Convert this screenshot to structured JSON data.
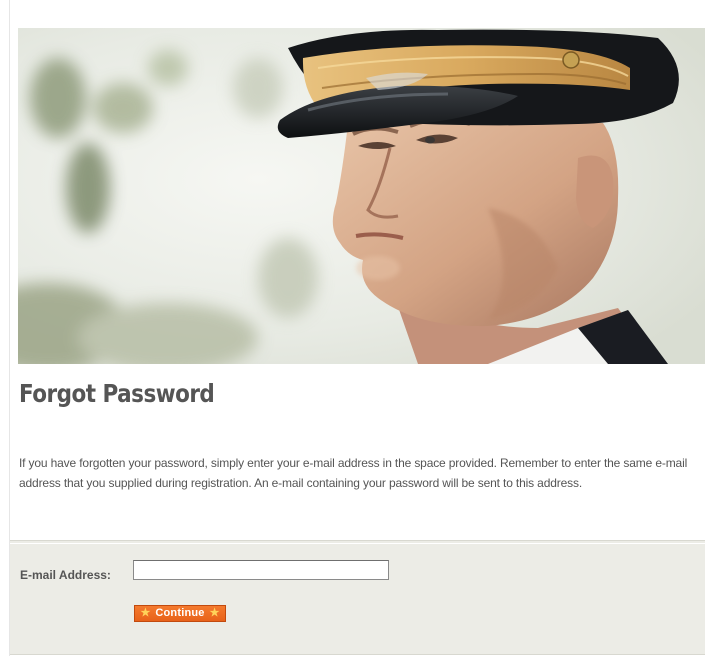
{
  "hero": {
    "image_name": "officer-portrait"
  },
  "page_title": "Forgot Password",
  "intro_text": "If you have forgotten your password, simply enter your e-mail address in the space provided. Remember to enter the same e-mail address that you supplied during registration. An e-mail containing your password will be sent to this address.",
  "form": {
    "email_label": "E-mail Address:",
    "email_value": "",
    "email_placeholder": "",
    "continue_label": "Continue",
    "star_icon": "★"
  },
  "colors": {
    "button_orange": "#ec6a22",
    "button_star": "#ffd35a",
    "panel_background": "#ecece6",
    "title_text": "#555555"
  }
}
